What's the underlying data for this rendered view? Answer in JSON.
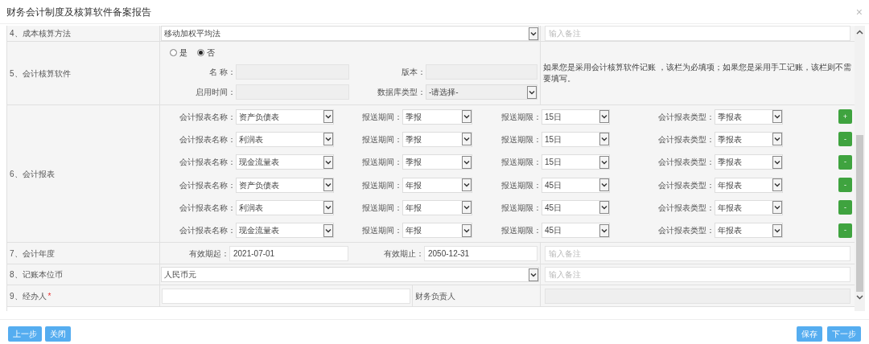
{
  "dialog": {
    "title": "财务会计制度及核算软件备案报告",
    "close": "×"
  },
  "cost_method": {
    "label": "4、成本核算方法",
    "value": "移动加权平均法",
    "remark_placeholder": "输入备注"
  },
  "software": {
    "label": "5、会计核算软件",
    "options": [
      {
        "label": "是",
        "selected": false
      },
      {
        "label": "否",
        "selected": true
      }
    ],
    "name_label": "名 称：",
    "version_label": "版本：",
    "start_label": "启用时间：",
    "db_label": "数据库类型：",
    "db_value": "-请选择-",
    "note": "如果您是采用会计核算软件记账 ，该栏为必填项；如果您是采用手工记账，该栏则不需要填写。"
  },
  "reports": {
    "label": "6、会计报表",
    "rows": [
      {
        "name_label": "会计报表名称：",
        "name": "资产负债表",
        "period_label": "报送期间：",
        "period": "季报",
        "deadline_label": "报送期限：",
        "deadline": "15日",
        "type_label": "会计报表类型：",
        "type": "季报表",
        "action": "+"
      },
      {
        "name_label": "会计报表名称：",
        "name": "利润表",
        "period_label": "报送期间：",
        "period": "季报",
        "deadline_label": "报送期限：",
        "deadline": "15日",
        "type_label": "会计报表类型：",
        "type": "季报表",
        "action": "-"
      },
      {
        "name_label": "会计报表名称：",
        "name": "现金流量表",
        "period_label": "报送期间：",
        "period": "季报",
        "deadline_label": "报送期限：",
        "deadline": "15日",
        "type_label": "会计报表类型：",
        "type": "季报表",
        "action": "-"
      },
      {
        "name_label": "会计报表名称：",
        "name": "资产负债表",
        "period_label": "报送期间：",
        "period": "年报",
        "deadline_label": "报送期限：",
        "deadline": "45日",
        "type_label": "会计报表类型：",
        "type": "年报表",
        "action": "-"
      },
      {
        "name_label": "会计报表名称：",
        "name": "利润表",
        "period_label": "报送期间：",
        "period": "年报",
        "deadline_label": "报送期限：",
        "deadline": "45日",
        "type_label": "会计报表类型：",
        "type": "年报表",
        "action": "-"
      },
      {
        "name_label": "会计报表名称：",
        "name": "现金流量表",
        "period_label": "报送期间：",
        "period": "年报",
        "deadline_label": "报送期限：",
        "deadline": "45日",
        "type_label": "会计报表类型：",
        "type": "年报表",
        "action": "-"
      }
    ]
  },
  "fiscal_year": {
    "label": "7、会计年度",
    "start_label": "有效期起：",
    "start": "2021-07-01",
    "end_label": "有效期止：",
    "end": "2050-12-31",
    "remark_placeholder": "输入备注"
  },
  "currency": {
    "label": "8、记账本位币",
    "value": "人民币元",
    "remark_placeholder": "输入备注"
  },
  "handler": {
    "label": "9、经办人",
    "required_mark": "*",
    "finance_head_label": "财务负责人"
  },
  "footer": {
    "left_buttons": [
      "上一步",
      "关闭"
    ],
    "right_buttons": [
      "保存",
      "下一步"
    ]
  }
}
